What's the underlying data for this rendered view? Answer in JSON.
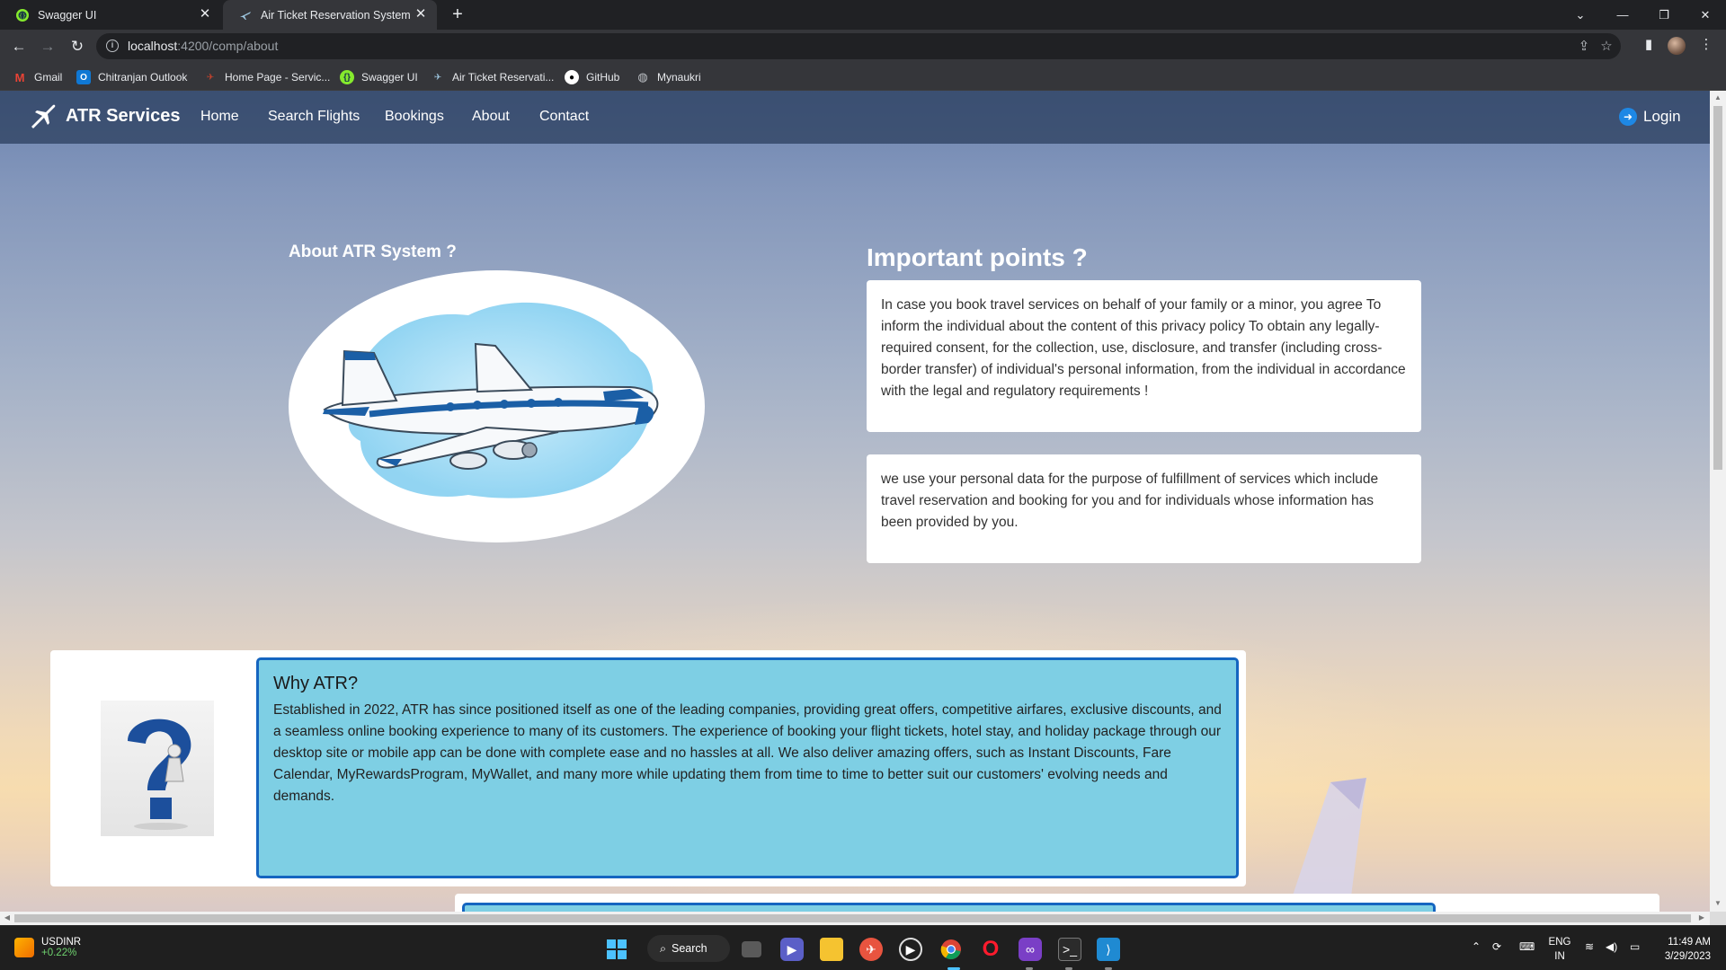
{
  "browser": {
    "tabs": [
      {
        "title": "Swagger UI",
        "active": false
      },
      {
        "title": "Air Ticket Reservation System",
        "active": true
      }
    ],
    "url_host": "localhost",
    "url_path": ":4200/comp/about",
    "bookmarks": [
      "Gmail",
      "Chitranjan Outlook",
      "Home Page - Servic...",
      "Swagger UI",
      "Air Ticket Reservati...",
      "GitHub",
      "Mynaukri"
    ]
  },
  "app": {
    "brand": "ATR Services",
    "nav": [
      "Home",
      "Search Flights",
      "Bookings",
      "About",
      "Contact"
    ],
    "login_label": "Login"
  },
  "about": {
    "title": "About ATR System ?"
  },
  "points": {
    "title": "Important points ?",
    "card1": "In case you book travel services on behalf of your family or a minor, you agree To inform the individual about the content of this privacy policy To obtain any legally-required consent, for the collection, use, disclosure, and transfer (including cross-border transfer) of individual's personal information, from the individual in accordance with the legal and regulatory requirements !",
    "card2": "we use your personal data for the purpose of fulfillment of services which include travel reservation and booking for you and for individuals whose information has been provided by you."
  },
  "why": {
    "title": "Why ATR?",
    "text": "Established in 2022, ATR has since positioned itself as one of the leading companies, providing great offers, competitive airfares, exclusive discounts, and a seamless online booking experience to many of its customers. The experience of booking your flight tickets, hotel stay, and holiday package through our desktop site or mobile app can be done with complete ease and no hassles at all. We also deliver amazing offers, such as Instant Discounts, Fare Calendar, MyRewardsProgram, MyWallet, and many more while updating them from time to time to better suit our customers' evolving needs and demands."
  },
  "taskbar": {
    "stock_name": "USDINR",
    "stock_change": "+0.22%",
    "search_label": "Search",
    "lang_line1": "ENG",
    "lang_line2": "IN",
    "time": "11:49 AM",
    "date": "3/29/2023"
  },
  "colors": {
    "navbar": "#2c4468",
    "why_box": "#7ecfe4",
    "why_border": "#1565c0",
    "login_icon": "#1e88e5"
  }
}
